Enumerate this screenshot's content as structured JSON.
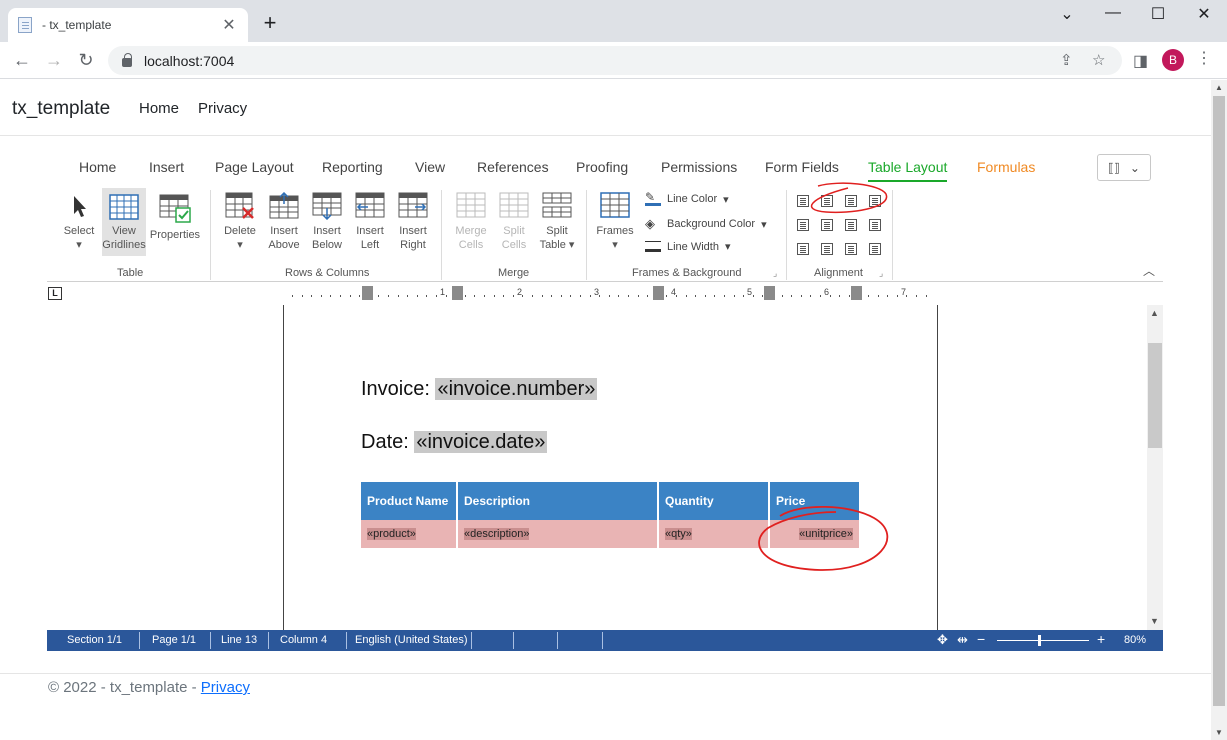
{
  "browser": {
    "tab_title": "- tx_template",
    "url": "localhost:7004",
    "profile_initial": "B"
  },
  "site": {
    "brand": "tx_template",
    "nav": [
      "Home",
      "Privacy"
    ]
  },
  "ribbon": {
    "tabs": [
      "Home",
      "Insert",
      "Page Layout",
      "Reporting",
      "View",
      "References",
      "Proofing",
      "Permissions",
      "Form Fields",
      "Table Layout",
      "Formulas"
    ],
    "active_tab": "Table Layout",
    "groups": {
      "table": {
        "label": "Table",
        "select": "Select",
        "view_gridlines_1": "View",
        "view_gridlines_2": "Gridlines",
        "properties": "Properties"
      },
      "rows_columns": {
        "label": "Rows & Columns",
        "delete": "Delete",
        "insert_above_1": "Insert",
        "insert_above_2": "Above",
        "insert_below_1": "Insert",
        "insert_below_2": "Below",
        "insert_left_1": "Insert",
        "insert_left_2": "Left",
        "insert_right_1": "Insert",
        "insert_right_2": "Right"
      },
      "merge": {
        "label": "Merge",
        "merge_cells_1": "Merge",
        "merge_cells_2": "Cells",
        "split_cells_1": "Split",
        "split_cells_2": "Cells",
        "split_table_1": "Split",
        "split_table_2": "Table ▾"
      },
      "frames": {
        "label": "Frames & Background",
        "frames": "Frames",
        "line_color": "Line Color",
        "background_color": "Background Color",
        "line_width": "Line Width"
      },
      "alignment": {
        "label": "Alignment"
      }
    }
  },
  "ruler": {
    "numbers": [
      "1",
      "2",
      "3",
      "4",
      "5",
      "6",
      "7"
    ],
    "corner": "L"
  },
  "document": {
    "invoice_label": "Invoice: ",
    "invoice_field": "«invoice.number»",
    "date_label": "Date: ",
    "date_field": "«invoice.date»",
    "table": {
      "headers": [
        "Product Name",
        "Description",
        "Quantity",
        "Price"
      ],
      "row": [
        "«product»",
        "«description»",
        "«qty»",
        "«unitprice»"
      ]
    }
  },
  "statusbar": {
    "section": "Section 1/1",
    "page": "Page 1/1",
    "line": "Line 13",
    "column": "Column 4",
    "language": "English (United States)",
    "zoom": "80%"
  },
  "footer": {
    "copyright": "© 2022 - tx_template - ",
    "privacy": "Privacy"
  },
  "colors": {
    "active_tab": "#1aa82a",
    "formulas_tab": "#f08a24",
    "header_fill": "#3b83c5",
    "row_fill": "#e9b4b4",
    "statusbar": "#2b579a",
    "annotation": "#e0201f"
  }
}
